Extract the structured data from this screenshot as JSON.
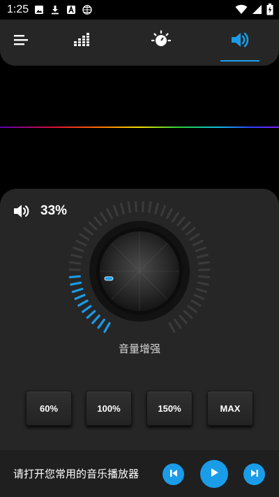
{
  "status_bar": {
    "time": "1:25",
    "left_icons": [
      "image-icon",
      "download-icon",
      "a-app-icon",
      "grid-globe-icon"
    ],
    "right_icons": [
      "wifi-icon",
      "signal-icon",
      "battery-charging-icon"
    ]
  },
  "tabs": [
    {
      "name": "menu",
      "icon": "menu-icon"
    },
    {
      "name": "equalizer",
      "icon": "equalizer-icon"
    },
    {
      "name": "visualizer",
      "icon": "sun-dial-icon"
    },
    {
      "name": "volume-boost",
      "icon": "speaker-loud-icon",
      "selected": true
    }
  ],
  "colors": {
    "accent": "#1a9ce8",
    "panel": "#262626",
    "background": "#000000"
  },
  "volume": {
    "percent_text": "33%",
    "level": 0.33
  },
  "knob": {
    "label": "音量增强",
    "level": 0.33
  },
  "presets": [
    {
      "label": "60%"
    },
    {
      "label": "100%"
    },
    {
      "label": "150%"
    },
    {
      "label": "MAX"
    }
  ],
  "player": {
    "prompt": "请打开您常用的音乐播放器",
    "controls": [
      "previous-icon",
      "play-icon",
      "next-icon"
    ]
  }
}
